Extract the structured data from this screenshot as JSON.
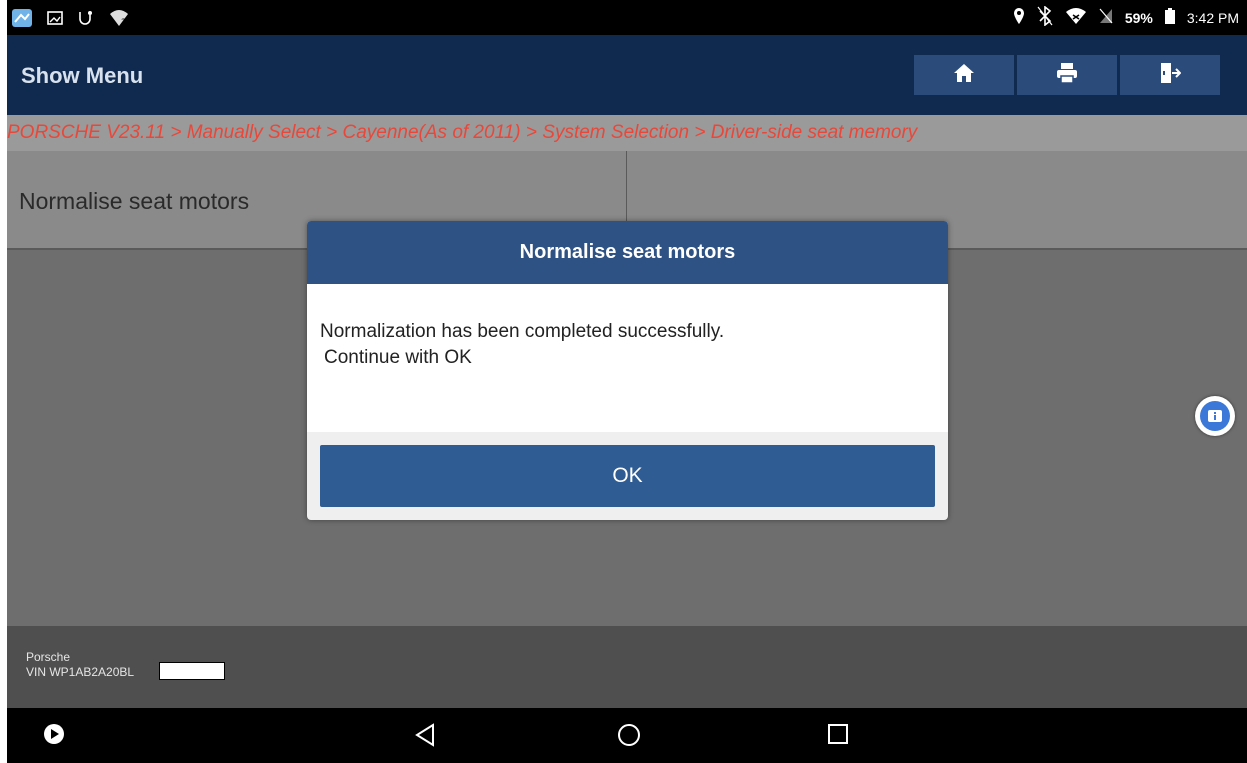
{
  "status_bar": {
    "battery": "59%",
    "time": "3:42 PM",
    "left_icons": [
      "app-icon",
      "image-icon",
      "usb-icon",
      "wifi-question-icon"
    ],
    "right_icons": [
      "location-icon",
      "bluetooth-icon",
      "wifi-icon",
      "no-signal-icon",
      "battery-icon"
    ]
  },
  "header": {
    "title": "Show Menu",
    "buttons": [
      "home-icon",
      "print-icon",
      "exit-icon"
    ]
  },
  "breadcrumb": "PORSCHE V23.11 > Manually Select > Cayenne(As of 2011) > System Selection > Driver-side seat memory",
  "menu": {
    "items": [
      "Normalise seat motors",
      ""
    ]
  },
  "dialog": {
    "title": "Normalise seat motors",
    "message_line1": "Normalization has been completed successfully.",
    "message_line2": "Continue with OK",
    "ok_label": "OK"
  },
  "footer": {
    "make": "Porsche",
    "vin": "VIN WP1AB2A20BL"
  },
  "navbar": {
    "buttons": [
      "play-icon",
      "back-icon",
      "home-circle-icon",
      "recents-icon"
    ]
  },
  "colors": {
    "header_bg": "#0f2a4e",
    "dialog_header": "#2e5284",
    "ok_button": "#2f5c93",
    "breadcrumb_text": "#e8483a"
  }
}
